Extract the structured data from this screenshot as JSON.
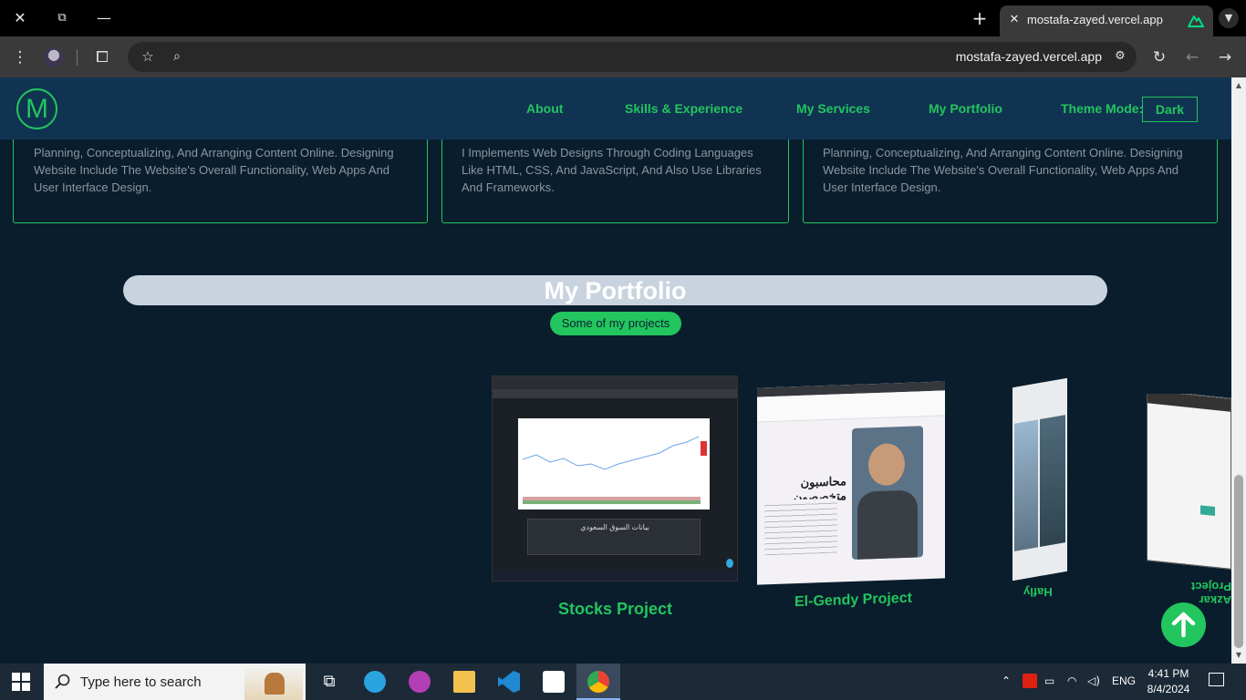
{
  "browser": {
    "tab_title": "mostafa-zayed.vercel.app",
    "url": "mostafa-zayed.vercel.app",
    "new_tab_icon": "plus-icon",
    "close_icon": "close-icon"
  },
  "header": {
    "logo_letter": "M",
    "nav": [
      "About",
      "Skills & Experience",
      "My Services",
      "My Portfolio"
    ],
    "theme_label": "Theme Mode:",
    "theme_value": "Dark"
  },
  "services": [
    {
      "text": "Planning, Conceptualizing, And Arranging Content Online. Designing Website Include The Website's Overall Functionality, Web Apps And User Interface Design."
    },
    {
      "text": "I Implements Web Designs Through Coding Languages Like HTML, CSS, And JavaScript, And Also Use Libraries And Frameworks."
    },
    {
      "text": "Planning, Conceptualizing, And Arranging Content Online. Designing Website Include The Website's Overall Functionality, Web Apps And User Interface Design."
    }
  ],
  "portfolio": {
    "title": "My Portfolio",
    "subtitle": "Some of my projects",
    "projects": [
      {
        "name": "Stocks Project",
        "shot_heading": "بيانات السوق السعودي"
      },
      {
        "name": "El-Gendy Project",
        "shot_heading": "محاسبون متخصصون"
      },
      {
        "name": "Hafly"
      },
      {
        "name": "Azkar Project"
      }
    ]
  },
  "taskbar": {
    "search_placeholder": "Type here to search",
    "lang": "ENG",
    "time": "4:41 PM",
    "date": "8/4/2024"
  },
  "colors": {
    "accent": "#22c55e",
    "page_bg": "#0a1d2c",
    "header_bg": "#113352"
  }
}
